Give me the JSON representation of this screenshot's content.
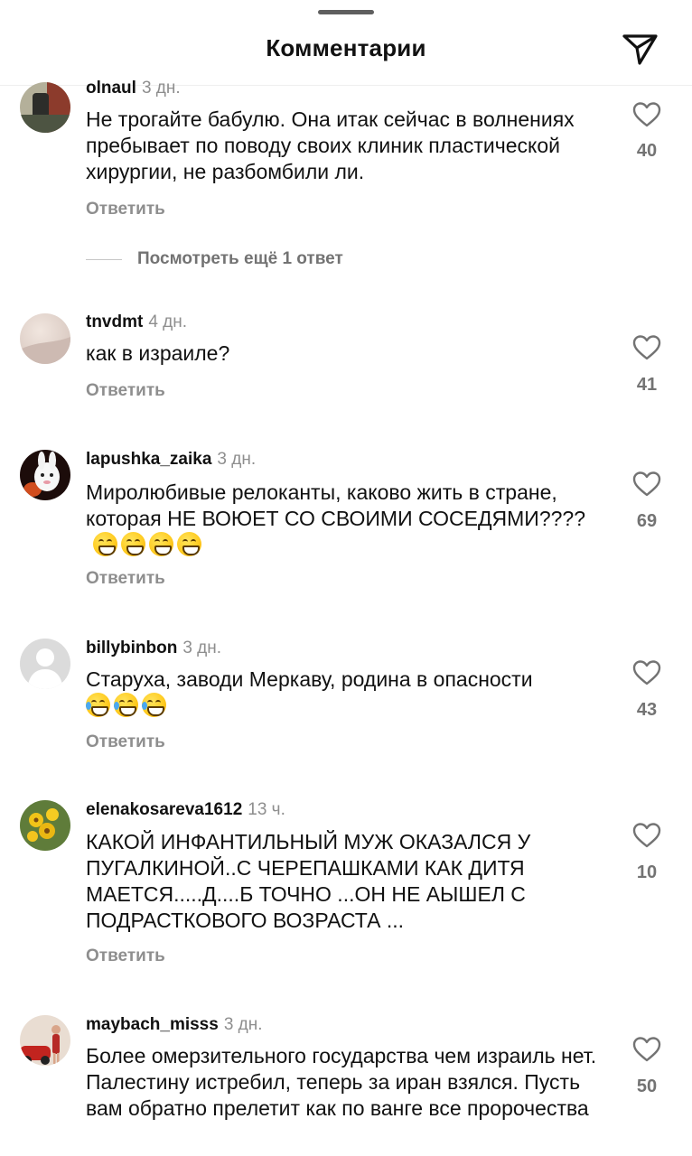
{
  "header": {
    "title": "Комментарии",
    "share_icon": "paper-plane-icon"
  },
  "like_icon": "heart-outline-icon",
  "reply_label": "Ответить",
  "view_more": "Посмотреть ещё 1 ответ",
  "comments": [
    {
      "username": "olnaul",
      "time": "3 дн.",
      "text": "Не трогайте бабулю. Она итак сейчас в волнениях пребывает по поводу своих клиник пластической хирургии, не разбомбили ли.",
      "likes": "40",
      "avatar": "photo-avatar"
    },
    {
      "username": "tnvdmt",
      "time": "4 дн.",
      "text": "как в израиле?",
      "likes": "41",
      "avatar": "beige-avatar"
    },
    {
      "username": "lapushka_zaika",
      "time": "3 дн.",
      "text": "Миролюбивые релоканты, каково жить в стране, которая НЕ ВОЮЕТ СО СВОИМИ СОСЕДЯМИ????",
      "emoji": "😁😁😁😁",
      "likes": "69",
      "avatar": "bunny-avatar"
    },
    {
      "username": "billybinbon",
      "time": "3 дн.",
      "text": "Старуха, заводи Меркаву, родина в опасности",
      "emoji": "😂😂😂",
      "likes": "43",
      "avatar": "default-avatar"
    },
    {
      "username": "elenakosareva1612",
      "time": "13 ч.",
      "text": "КАКОЙ ИНФАНТИЛЬНЫЙ МУЖ ОКАЗАЛСЯ У ПУГАЛКИНОЙ..С ЧЕРЕПАШКАМИ КАК ДИТЯ МАЕТСЯ.....Д....Б ТОЧНО ...ОН НЕ АЫШЕЛ С ПОДРАСТКОВОГО ВОЗРАСТА ...",
      "likes": "10",
      "avatar": "flowers-avatar"
    },
    {
      "username": "maybach_misss",
      "time": "3 дн.",
      "text": "Более омерзительного государства чем израиль нет. Палестину истребил, теперь за иран взялся. Пусть вам обратно прелетит как по ванге все пророчества",
      "likes": "50",
      "avatar": "car-avatar"
    }
  ]
}
